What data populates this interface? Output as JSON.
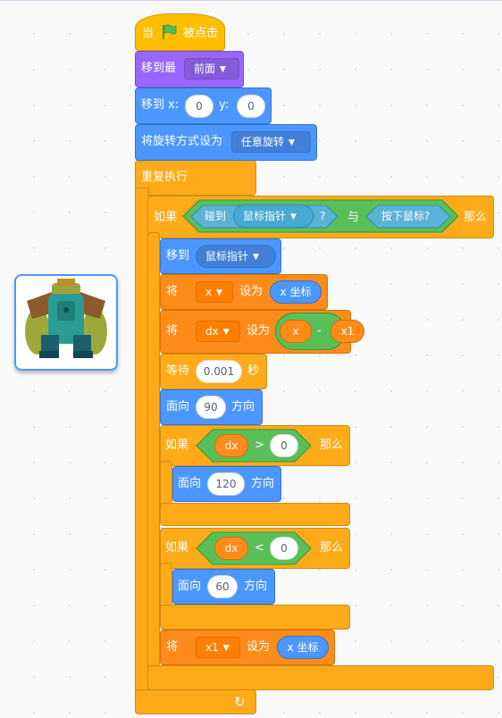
{
  "sprite": {
    "name": "troll-sprite"
  },
  "script": {
    "when_flag": {
      "prefix": "当",
      "suffix": "被点击"
    },
    "go_to_layer": {
      "label": "移到最",
      "value": "前面"
    },
    "go_to_xy": {
      "label": "移到 x:",
      "x_value": "0",
      "y_label": "y:",
      "y_value": "0"
    },
    "rotation_style": {
      "label": "将旋转方式设为",
      "value": "任意旋转"
    },
    "forever": {
      "label": "重复执行"
    },
    "if1": {
      "label": "如果",
      "then": "那么",
      "touching_label": "碰到",
      "touching_value": "鼠标指针",
      "question": "?",
      "and_label": "与",
      "mouse_down": "按下鼠标?"
    },
    "go_to": {
      "label": "移到",
      "value": "鼠标指针"
    },
    "set_x": {
      "label": "将",
      "var": "x",
      "set_label": "设为",
      "reporter": "x 坐标"
    },
    "set_dx": {
      "label": "将",
      "var": "dx",
      "set_label": "设为",
      "left": "x",
      "op": "-",
      "right": "x1"
    },
    "wait": {
      "label": "等待",
      "value": "0.001",
      "unit": "秒"
    },
    "point90": {
      "label": "面向",
      "value": "90",
      "unit": "方向"
    },
    "if2": {
      "label": "如果",
      "left": "dx",
      "op": ">",
      "right": "0",
      "then": "那么"
    },
    "point120": {
      "label": "面向",
      "value": "120",
      "unit": "方向"
    },
    "if3": {
      "label": "如果",
      "left": "dx",
      "op": "<",
      "right": "0",
      "then": "那么"
    },
    "point60": {
      "label": "面向",
      "value": "60",
      "unit": "方向"
    },
    "set_x1": {
      "label": "将",
      "var": "x1",
      "set_label": "设为",
      "reporter": "x 坐标"
    },
    "loop_arrow": "↻"
  },
  "colors": {
    "motion": "#4c97ff",
    "looks": "#9966ff",
    "events": "#ffbf00",
    "control": "#ffab19",
    "variables": "#ff8c1a",
    "operators": "#59c059",
    "sensing": "#5cb1d6"
  }
}
